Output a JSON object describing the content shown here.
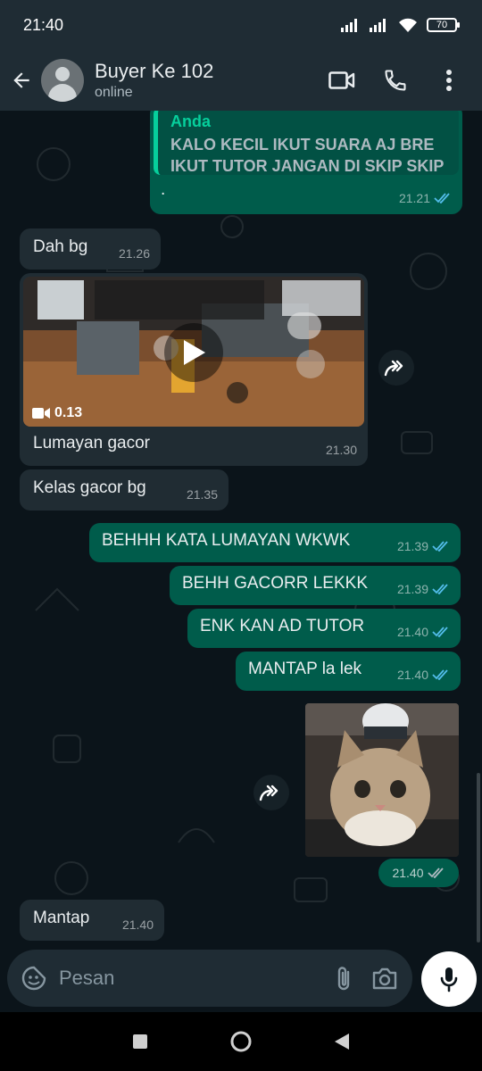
{
  "status_bar": {
    "time": "21:40",
    "battery": "70"
  },
  "header": {
    "contact_name": "Buyer Ke 102",
    "contact_status": "online"
  },
  "messages": [
    {
      "type": "outgoing_reply",
      "quoted_author": "Anda",
      "quoted_text": "KALO KECIL IKUT SUARA AJ BRE IKUT TUTOR JANGAN DI SKIP SKIP",
      "text": ".",
      "time": "21.21"
    },
    {
      "type": "incoming",
      "text": "Dah bg",
      "time": "21.26"
    },
    {
      "type": "incoming_video",
      "duration": "0.13",
      "caption": "Lumayan gacor",
      "time": "21.30"
    },
    {
      "type": "incoming",
      "text": "Kelas gacor bg",
      "time": "21.35"
    },
    {
      "type": "outgoing",
      "text": "BEHHH KATA LUMAYAN WKWK",
      "time": "21.39"
    },
    {
      "type": "outgoing",
      "text": "BEHH GACORR LEKKK",
      "time": "21.39"
    },
    {
      "type": "outgoing",
      "text": "ENK KAN AD TUTOR",
      "time": "21.40"
    },
    {
      "type": "outgoing",
      "text": "MANTAP la lek",
      "time": "21.40"
    },
    {
      "type": "outgoing_image",
      "time": "21.40"
    },
    {
      "type": "incoming",
      "text": "Mantap",
      "time": "21.40"
    }
  ],
  "input": {
    "placeholder": "Pesan"
  },
  "colors": {
    "incoming_bubble": "#202c33",
    "outgoing_bubble": "#005c4b",
    "read_tick": "#53bdeb",
    "quote_bar": "#06cf9c"
  }
}
